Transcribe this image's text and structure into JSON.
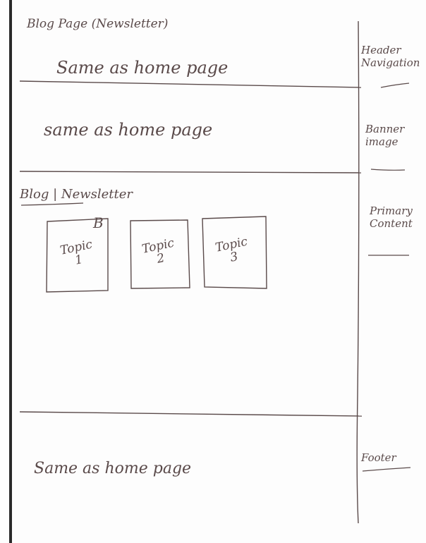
{
  "sketch": {
    "page_title": "Blog Page (Newsletter)",
    "header_note": "Same as home page",
    "banner_note": "same as home page",
    "content_heading": "Blog | Newsletter",
    "topic_cards": [
      {
        "label": "Topic\n1",
        "mark": "B"
      },
      {
        "label": "Topic\n2",
        "mark": ""
      },
      {
        "label": "Topic\n3",
        "mark": ""
      }
    ],
    "footer_note": "Same as home page"
  },
  "annotations": {
    "header": "Header\nNavigation",
    "banner": "Banner\nimage",
    "primary": "Primary\nContent",
    "footer": "Footer"
  }
}
